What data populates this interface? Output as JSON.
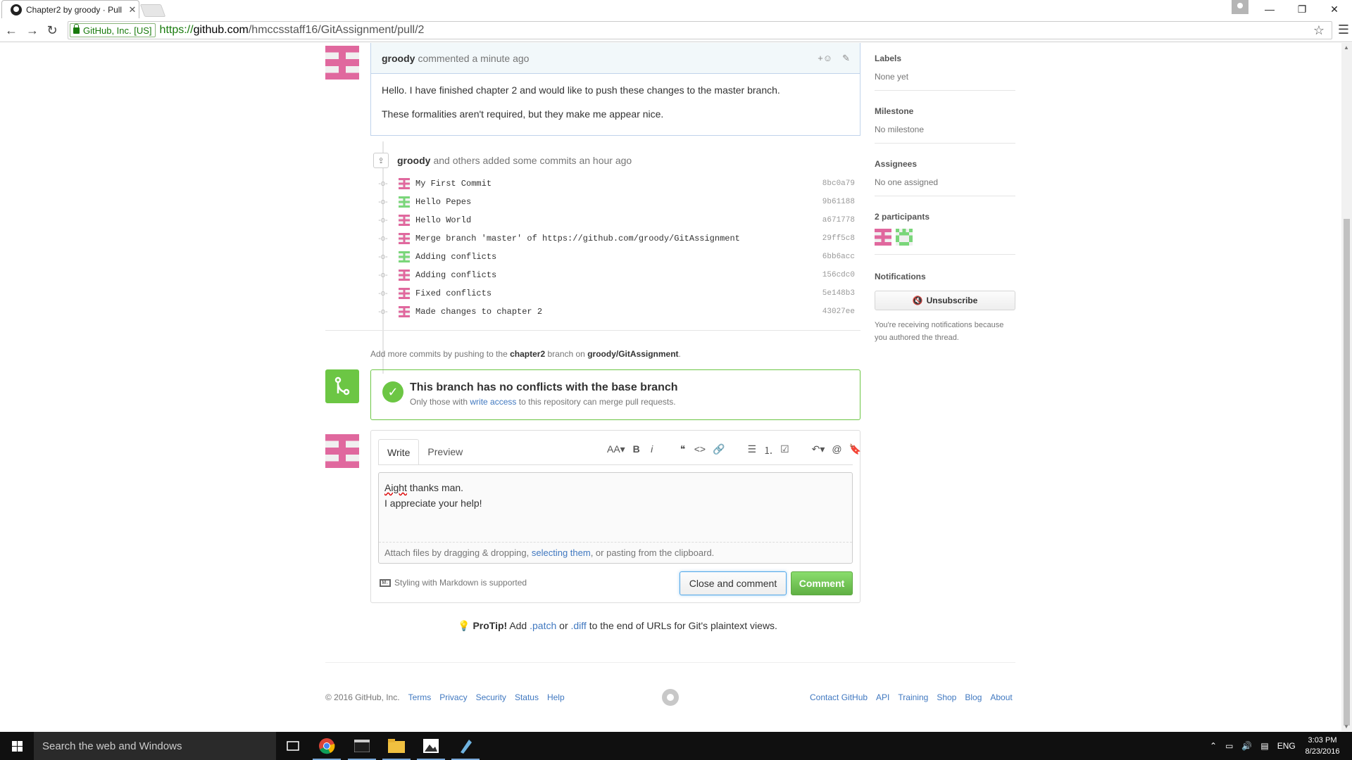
{
  "browser": {
    "tab_title": "Chapter2 by groody · Pull",
    "tab_close": "✕",
    "secure_label": "GitHub, Inc. [US]",
    "url_scheme": "https://",
    "url_host": "github.com",
    "url_path": "/hmccsstaff16/GitAssignment/pull/2"
  },
  "comment": {
    "author": "groody",
    "meta": "commented a minute ago",
    "reaction": "+☺",
    "body": [
      "Hello. I have finished chapter 2 and would like to push these changes to the master branch.",
      "These formalities aren't required, but they make me appear nice."
    ]
  },
  "commits": {
    "author": "groody",
    "meta": "and others added some commits an hour ago",
    "items": [
      {
        "message": "My First Commit",
        "sha": "8bc0a79",
        "author_color": "pink"
      },
      {
        "message": "Hello Pepes",
        "sha": "9b61188",
        "author_color": "green"
      },
      {
        "message": "Hello World",
        "sha": "a671778",
        "author_color": "pink"
      },
      {
        "message": "Merge branch 'master' of https://github.com/groody/GitAssignment",
        "sha": "29ff5c8",
        "author_color": "pink"
      },
      {
        "message": "Adding conflicts",
        "sha": "6bb6acc",
        "author_color": "green"
      },
      {
        "message": "Adding conflicts",
        "sha": "156cdc0",
        "author_color": "pink"
      },
      {
        "message": "Fixed conflicts",
        "sha": "5e148b3",
        "author_color": "pink"
      },
      {
        "message": "Made changes to chapter 2",
        "sha": "43027ee",
        "author_color": "pink"
      }
    ]
  },
  "add_more": {
    "prefix": "Add more commits by pushing to the",
    "branch": "chapter2",
    "middle": "branch on",
    "repo": "groody/GitAssignment",
    "suffix": "."
  },
  "merge": {
    "heading": "This branch has no conflicts with the base branch",
    "sub_prefix": "Only those with",
    "sub_link": "write access",
    "sub_suffix": "to this repository can merge pull requests."
  },
  "form": {
    "tab_write": "Write",
    "tab_preview": "Preview",
    "text_line1_word": "Aight",
    "text_line1_rest": " thanks man.",
    "text_line2": "I appreciate your help!",
    "attach_prefix": "Attach files by dragging & dropping,",
    "attach_link": "selecting them",
    "attach_suffix": ", or pasting from the clipboard.",
    "markdown_note": "Styling with Markdown is supported",
    "close_button": "Close and comment",
    "comment_button": "Comment",
    "toolbar": [
      "AA▾",
      "B",
      "i",
      "❝",
      "<>",
      "🔗",
      "☰",
      "⒈",
      "☑",
      "↶▾",
      "@",
      "🔖"
    ]
  },
  "protip": {
    "label": "ProTip!",
    "prefix": "Add",
    "patch": ".patch",
    "or": "or",
    "diff": ".diff",
    "suffix": "to the end of URLs for Git's plaintext views."
  },
  "sidebar": {
    "labels_title": "Labels",
    "labels_value": "None yet",
    "milestone_title": "Milestone",
    "milestone_value": "No milestone",
    "assignees_title": "Assignees",
    "assignees_value": "No one assigned",
    "participants_title": "2 participants",
    "notifications_title": "Notifications",
    "unsubscribe": "Unsubscribe",
    "notif_note": "You're receiving notifications because you authored the thread."
  },
  "footer": {
    "copyright": "© 2016 GitHub, Inc.",
    "left_links": [
      "Terms",
      "Privacy",
      "Security",
      "Status",
      "Help"
    ],
    "right_links": [
      "Contact GitHub",
      "API",
      "Training",
      "Shop",
      "Blog",
      "About"
    ]
  },
  "taskbar": {
    "search_placeholder": "Search the web and Windows",
    "language": "ENG",
    "time": "3:03 PM",
    "date": "8/23/2016"
  },
  "colors": {
    "link": "#4078c0",
    "success": "#6cc644",
    "identicon_pink": "#e0689e",
    "identicon_green": "#7ad67a"
  }
}
